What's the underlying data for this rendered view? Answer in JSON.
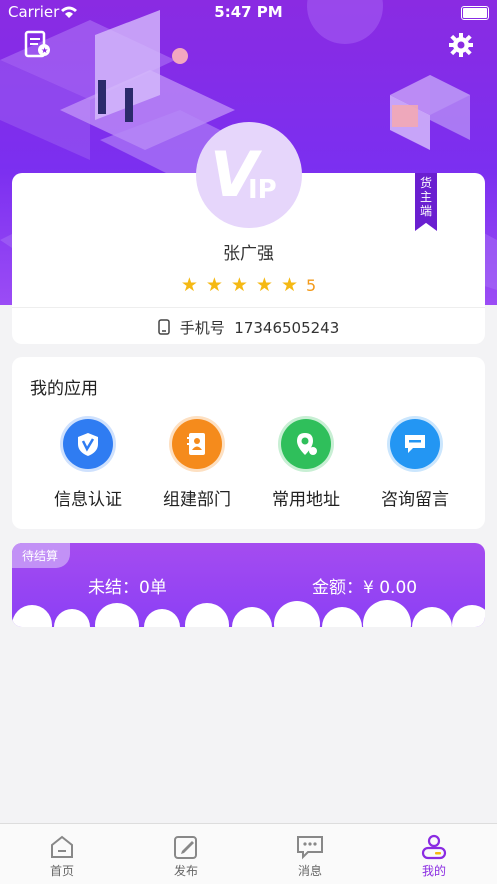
{
  "status_bar": {
    "carrier": "Carrier",
    "time": "5:47 PM"
  },
  "profile": {
    "avatar_text": "VIP",
    "ribbon": "货主端",
    "name": "张广强",
    "stars": "★★★★★",
    "rating": "5",
    "phone_label": "手机号",
    "phone": "17346505243"
  },
  "apps": {
    "title": "我的应用",
    "items": [
      {
        "label": "信息认证",
        "icon": "shield-v-icon",
        "color": "#2f7cf2"
      },
      {
        "label": "组建部门",
        "icon": "contacts-book-icon",
        "color": "#f58b1c"
      },
      {
        "label": "常用地址",
        "icon": "location-pin-icon",
        "color": "#2fbf5b"
      },
      {
        "label": "咨询留言",
        "icon": "chat-bubble-icon",
        "color": "#2396f3"
      }
    ]
  },
  "settlement": {
    "tag": "待结算",
    "unsettled": "未结：0单",
    "amount": "金额：¥ 0.00"
  },
  "tabs": [
    {
      "label": "首页",
      "icon": "home-icon"
    },
    {
      "label": "发布",
      "icon": "edit-icon"
    },
    {
      "label": "消息",
      "icon": "message-icon"
    },
    {
      "label": "我的",
      "icon": "profile-icon"
    }
  ],
  "colors": {
    "primary": "#8a2be2",
    "star": "#f5b914"
  }
}
